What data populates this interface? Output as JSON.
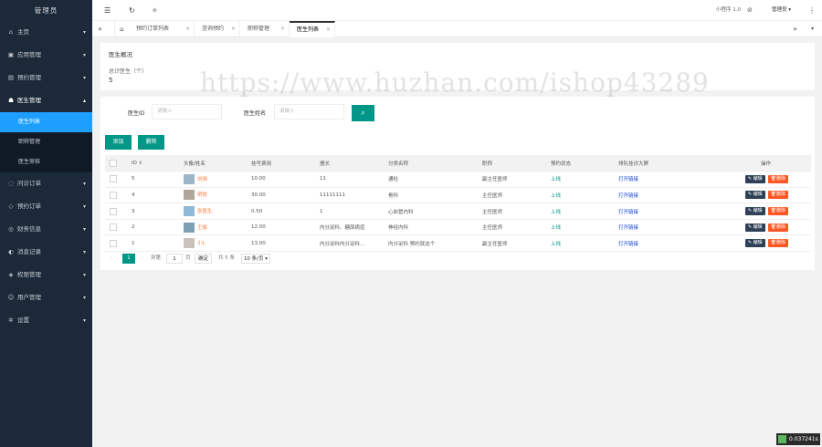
{
  "app": {
    "title": "管理员"
  },
  "sidebar": {
    "items": [
      {
        "label": "主页",
        "icon": "home-icon"
      },
      {
        "label": "应用管理",
        "icon": "app-icon"
      },
      {
        "label": "预约管理",
        "icon": "calendar-icon"
      },
      {
        "label": "医生管理",
        "icon": "users-icon",
        "expanded": true,
        "children": [
          {
            "label": "医生列表",
            "active": true
          },
          {
            "label": "职称管理"
          },
          {
            "label": "医生审核"
          }
        ]
      },
      {
        "label": "问诊订单",
        "icon": "chat-icon"
      },
      {
        "label": "预约订单",
        "icon": "order-icon"
      },
      {
        "label": "财务信息",
        "icon": "money-icon"
      },
      {
        "label": "消息记录",
        "icon": "message-icon"
      },
      {
        "label": "权限管理",
        "icon": "shield-icon"
      },
      {
        "label": "用户管理",
        "icon": "user-icon"
      },
      {
        "label": "设置",
        "icon": "gear-icon"
      }
    ]
  },
  "topbar": {
    "notice": "小程序 1.0",
    "user": "管理员"
  },
  "tabs": [
    {
      "label": "预约订单列表"
    },
    {
      "label": "咨询预约"
    },
    {
      "label": "职称管理"
    },
    {
      "label": "医生列表",
      "active": true
    }
  ],
  "overview": {
    "title": "医生概况",
    "count_label": "总计医生（个）",
    "count_value": "5"
  },
  "search": {
    "id_label": "医生ID",
    "id_placeholder": "请输入",
    "name_label": "医生姓名",
    "name_placeholder": "请输入"
  },
  "actions": {
    "add": "添加",
    "delete": "删除"
  },
  "table": {
    "columns": [
      "ID",
      "头像/姓名",
      "挂号费用",
      "擅长",
      "分类名称",
      "职称",
      "预约状态",
      "排队挂诊大屏",
      "操作"
    ],
    "rows": [
      {
        "id": "5",
        "name": "刘晓",
        "fee": "10.00",
        "skill": "11",
        "category": "通检",
        "title": "副主任医师",
        "status": "上线",
        "screen": "打开链接"
      },
      {
        "id": "4",
        "name": "明姓",
        "fee": "30.00",
        "skill": "11111111",
        "category": "骨科",
        "title": "主任医师",
        "status": "上线",
        "screen": "打开链接"
      },
      {
        "id": "3",
        "name": "张医生",
        "fee": "0.50",
        "skill": "1",
        "category": "心血管内科",
        "title": "主任医师",
        "status": "上线",
        "screen": "打开链接"
      },
      {
        "id": "2",
        "name": "王俊",
        "fee": "12.00",
        "skill": "内分泌科、糖尿病症",
        "category": "神经内科",
        "title": "主任医师",
        "status": "上线",
        "screen": "打开链接"
      },
      {
        "id": "1",
        "name": "小L",
        "fee": "13.00",
        "skill": "内分泌科内分泌科…",
        "category": "内分泌科 预约就这个",
        "title": "副主任医师",
        "status": "上线",
        "screen": "打开链接"
      }
    ],
    "edit_label": "编辑",
    "delete_label": "删除"
  },
  "pager": {
    "current": "1",
    "goto_label": "到第",
    "page_input": "1",
    "page_unit": "页",
    "confirm": "确定",
    "total": "共 5 条",
    "per_page": "10 条/页"
  },
  "watermark": "https://www.huzhan.com/ishop43289",
  "badge": "0.037241s",
  "colors": {
    "sidebar": "#1c2938",
    "active": "#1e9fff",
    "primary": "#009688",
    "danger": "#ff5722"
  }
}
